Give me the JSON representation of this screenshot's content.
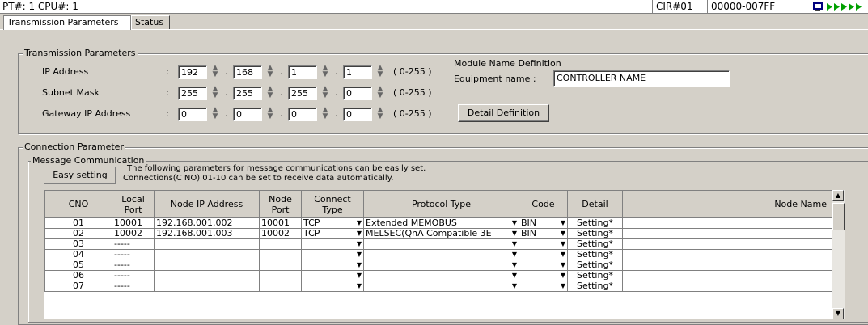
{
  "topbar": {
    "title": "PT#: 1 CPU#: 1",
    "cir": "CIR#01",
    "range": "00000-007FF"
  },
  "tabs": [
    {
      "label": "Transmission Parameters"
    },
    {
      "label": "Status"
    }
  ],
  "transmission": {
    "legend": "Transmission Parameters",
    "ip_label": "IP Address",
    "subnet_label": "Subnet Mask",
    "gateway_label": "Gateway IP Address",
    "colon": ":",
    "range_hint": "( 0-255 )",
    "ip": [
      "192",
      "168",
      "1",
      "1"
    ],
    "subnet": [
      "255",
      "255",
      "255",
      "0"
    ],
    "gateway": [
      "0",
      "0",
      "0",
      "0"
    ],
    "dot": "."
  },
  "module": {
    "title": "Module Name Definition",
    "equipment_label": "Equipment  name  :",
    "equipment_value": "CONTROLLER NAME",
    "detail_button": "Detail Definition"
  },
  "connection": {
    "legend": "Connection Parameter",
    "message_legend": "Message Communication",
    "easy_button": "Easy setting",
    "info_line1": "The following parameters for message communications can be easily set.",
    "info_line2": "Connections(C NO) 01-10 can be set to receive data automatically."
  },
  "table": {
    "headers": {
      "cno": "CNO",
      "local_port": "Local Port",
      "node_ip": "Node IP Address",
      "node_port": "Node Port",
      "connect_type": "Connect Type",
      "protocol_type": "Protocol Type",
      "code": "Code",
      "detail": "Detail",
      "node_name": "Node Name"
    },
    "rows": [
      {
        "cno": "01",
        "local_port": "10001",
        "node_ip": "192.168.001.002",
        "node_port": "10001",
        "connect": "TCP",
        "protocol": "Extended MEMOBUS",
        "code": "BIN",
        "detail": "Setting*",
        "node_name": ""
      },
      {
        "cno": "02",
        "local_port": "10002",
        "node_ip": "192.168.001.003",
        "node_port": "10002",
        "connect": "TCP",
        "protocol": "MELSEC(QnA Compatible 3E",
        "code": "BIN",
        "detail": "Setting*",
        "node_name": ""
      },
      {
        "cno": "03",
        "local_port": "-----",
        "node_ip": "",
        "node_port": "",
        "connect": "",
        "protocol": "",
        "code": "",
        "detail": "Setting*",
        "node_name": ""
      },
      {
        "cno": "04",
        "local_port": "-----",
        "node_ip": "",
        "node_port": "",
        "connect": "",
        "protocol": "",
        "code": "",
        "detail": "Setting*",
        "node_name": ""
      },
      {
        "cno": "05",
        "local_port": "-----",
        "node_ip": "",
        "node_port": "",
        "connect": "",
        "protocol": "",
        "code": "",
        "detail": "Setting*",
        "node_name": ""
      },
      {
        "cno": "06",
        "local_port": "-----",
        "node_ip": "",
        "node_port": "",
        "connect": "",
        "protocol": "",
        "code": "",
        "detail": "Setting*",
        "node_name": ""
      },
      {
        "cno": "07",
        "local_port": "-----",
        "node_ip": "",
        "node_port": "",
        "connect": "",
        "protocol": "",
        "code": "",
        "detail": "Setting*",
        "node_name": ""
      }
    ]
  },
  "icons": {
    "spin": "spin-updown-icon",
    "dropdown": "dropdown-arrow-icon",
    "status": "run-status-icon",
    "scroll_up": "scroll-up-icon",
    "scroll_down": "scroll-down-icon"
  },
  "colors": {
    "window": "#d4d0c8",
    "status_green": "#00a000"
  }
}
